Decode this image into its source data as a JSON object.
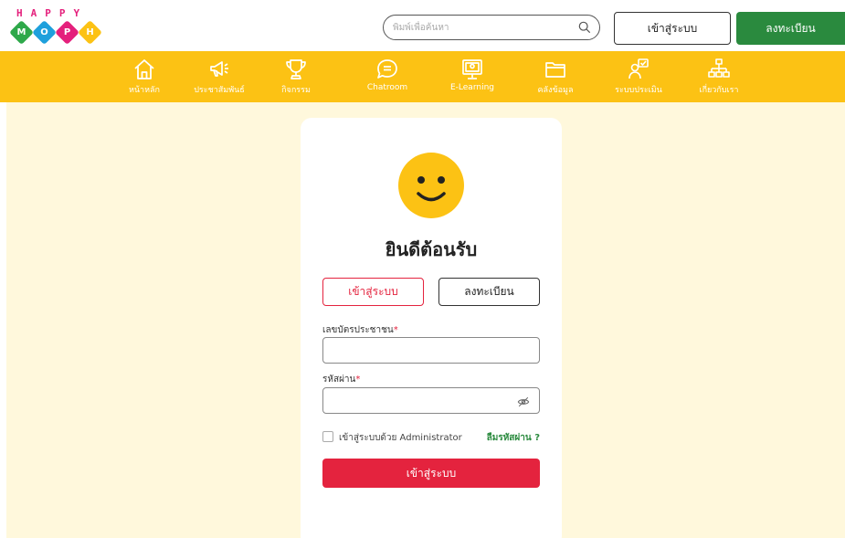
{
  "logo": {
    "letters": "HAPPY",
    "diamonds": [
      {
        "letter": "M",
        "color": "#2ea84a"
      },
      {
        "letter": "O",
        "color": "#1ea0dc"
      },
      {
        "letter": "P",
        "color": "#e4207c"
      },
      {
        "letter": "H",
        "color": "#fcc214"
      }
    ]
  },
  "header": {
    "search_placeholder": "พิมพ์เพื่อค้นหา",
    "login_label": "เข้าสู่ระบบ",
    "register_label": "ลงทะเบียน"
  },
  "nav": {
    "items": [
      {
        "label": "หน้าหลัก",
        "icon": "home-icon"
      },
      {
        "label": "ประชาสัมพันธ์",
        "icon": "megaphone-icon"
      },
      {
        "label": "กิจกรรม",
        "icon": "trophy-icon"
      },
      {
        "label": "Chatroom",
        "icon": "chat-icon"
      },
      {
        "label": "E-Learning",
        "icon": "monitor-icon"
      },
      {
        "label": "คลังข้อมูล",
        "icon": "folder-icon"
      },
      {
        "label": "ระบบประเมิน",
        "icon": "evaluation-icon"
      },
      {
        "label": "เกี่ยวกับเรา",
        "icon": "org-chart-icon"
      }
    ]
  },
  "card": {
    "welcome": "ยินดีต้อนรับ",
    "tab_login": "เข้าสู่ระบบ",
    "tab_register": "ลงทะเบียน",
    "id_label": "เลขบัตรประชาชน",
    "password_label": "รหัสผ่าน",
    "required_mark": "*",
    "admin_checkbox_label": "เข้าสู่ระบบด้วย Administrator",
    "forgot_password": "ลืมรหัสผ่าน ?",
    "submit_label": "เข้าสู่ระบบ"
  },
  "colors": {
    "nav_bg": "#fcc214",
    "page_bg": "#fff8dc",
    "brand_green": "#2a8a3e",
    "accent_red": "#e4233e",
    "smiley": "#fcc214"
  }
}
